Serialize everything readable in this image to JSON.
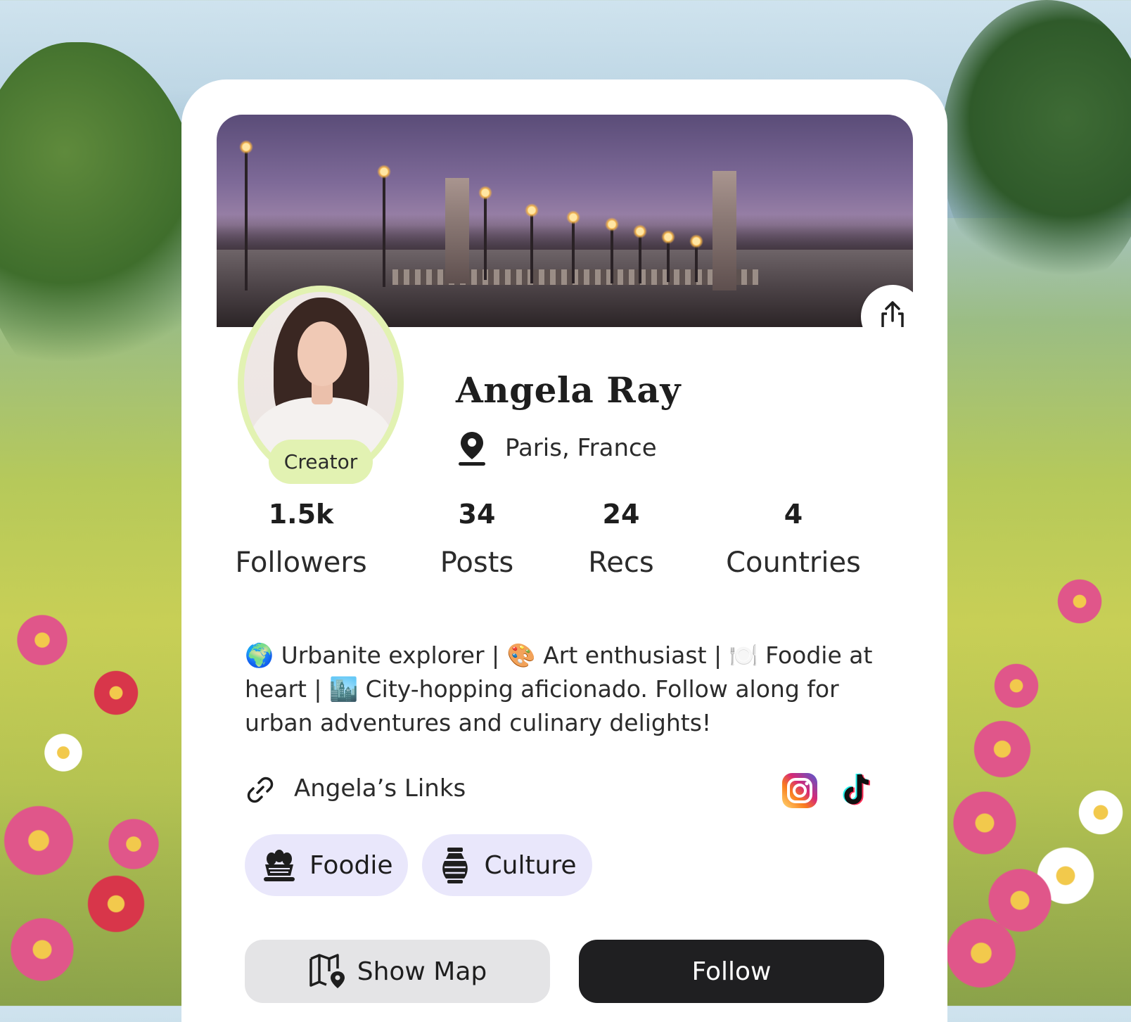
{
  "profile": {
    "name": "Angela Ray",
    "badge": "Creator",
    "location": "Paris, France"
  },
  "stats": [
    {
      "value": "1.5k",
      "label": "Followers"
    },
    {
      "value": "34",
      "label": "Posts"
    },
    {
      "value": "24",
      "label": "Recs"
    },
    {
      "value": "4",
      "label": "Countries"
    }
  ],
  "bio": "🌍 Urbanite explorer | 🎨 Art enthusiast | 🍽️ Foodie at heart | 🏙️ City-hopping aficionado. Follow along for urban adventures and culinary delights!",
  "links": {
    "label": "Angela’s Links",
    "social": [
      "instagram-icon",
      "tiktok-icon"
    ]
  },
  "tags": [
    {
      "label": "Foodie",
      "icon": "bread-basket-icon"
    },
    {
      "label": "Culture",
      "icon": "vase-icon"
    }
  ],
  "actions": {
    "show_map": "Show Map",
    "follow": "Follow"
  },
  "colors": {
    "badge_bg": "#e2f2b2",
    "chip_bg": "#e9e7fb",
    "follow_bg": "#1f1f21",
    "map_bg": "#e4e4e6"
  }
}
